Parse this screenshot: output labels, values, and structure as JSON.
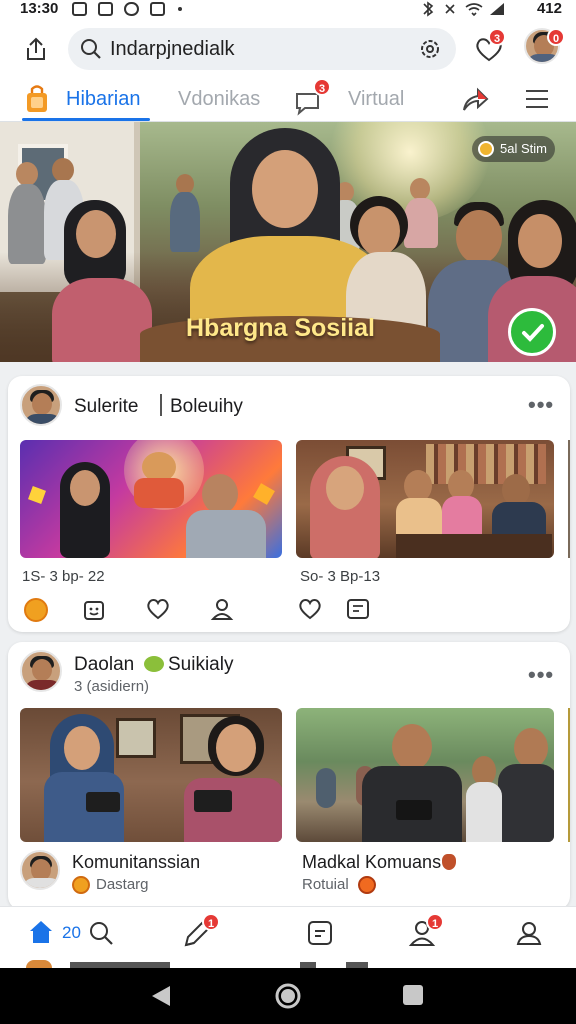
{
  "status_bar": {
    "time": "13:30",
    "battery": "412"
  },
  "search": {
    "value": "Indarpjnedialk"
  },
  "header": {
    "notifications_count": "3",
    "profile_badge_count": "0"
  },
  "tabs": [
    {
      "label": "Hibarian",
      "active": true
    },
    {
      "label": "Vdonikas",
      "active": false
    },
    {
      "label": "Virtual",
      "active": false
    }
  ],
  "tabs_chat_badge": "3",
  "hero": {
    "title": "Hbargna Sosiial",
    "tag": "5al Stim"
  },
  "post1": {
    "author": "Sulerite",
    "subtitle": "Boleuihy",
    "items": [
      {
        "meta": "1S- 3 bp- 22"
      },
      {
        "meta": "So- 3 Bp-13"
      }
    ]
  },
  "post2": {
    "author": "Daolan",
    "author_suffix": "Suikialy",
    "subtitle": "3 (asidiern)",
    "items": [
      {
        "name": "Komunitanssian",
        "sub": "Dastarg"
      },
      {
        "name": "Madkal Komuans",
        "sub": "Rotuial"
      }
    ]
  },
  "bottom_nav": {
    "home_count": "20",
    "post_badge": "1",
    "people_badge": "1"
  },
  "colors": {
    "accent": "#1a73e8",
    "badge": "#e53935",
    "check": "#2dbb3c",
    "hero_title": "#ffe88a"
  },
  "icons": {
    "status": [
      "photo-icon",
      "image-icon",
      "chat-icon",
      "game-icon",
      "bluetooth-icon",
      "mute-icon",
      "wifi-icon",
      "signal-icon"
    ],
    "top": [
      "share-icon",
      "search-icon",
      "settings-icon",
      "heart-icon",
      "avatar"
    ],
    "tabs": [
      "shopping-bag-icon",
      "chat-bubble-icon",
      "share-arrow-icon",
      "menu-icon"
    ],
    "nav": [
      "home-icon",
      "search-icon",
      "edit-icon",
      "note-icon",
      "person-icon",
      "profile-icon"
    ]
  }
}
